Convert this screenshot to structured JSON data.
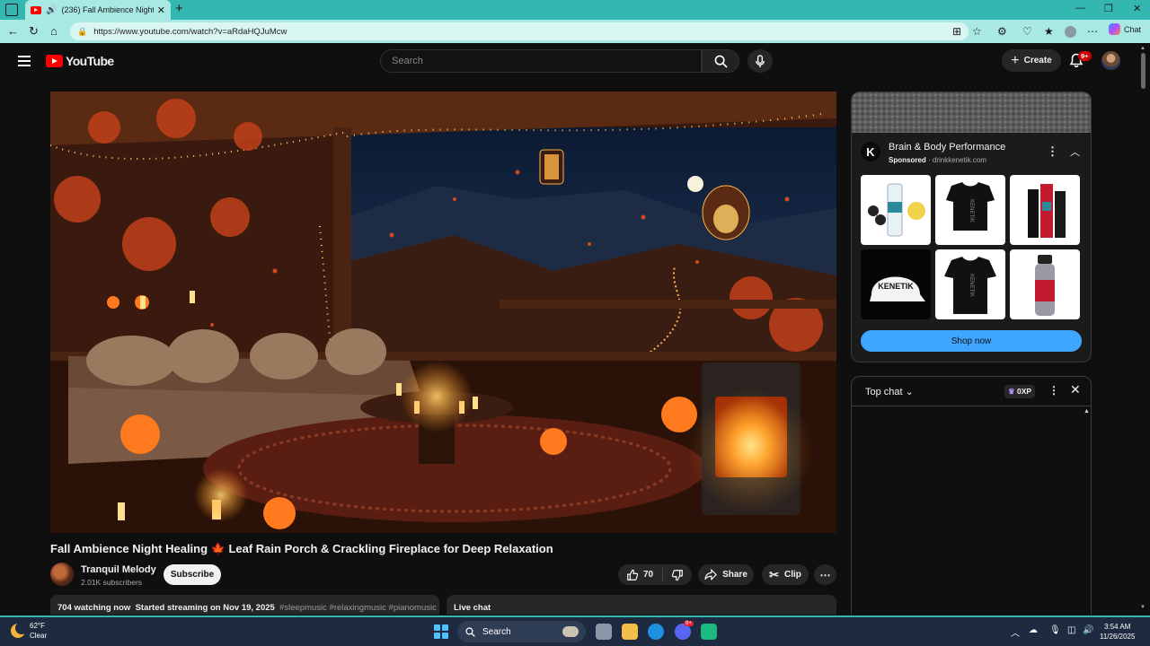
{
  "browser": {
    "tab_title": "(236) Fall Ambience Night H",
    "tab_close": "✕",
    "new_tab": "+",
    "url": "https://www.youtube.com/watch?v=aRdaHQJuMcw",
    "chat_label": "Chat",
    "min": "—",
    "max": "❐",
    "close": "✕"
  },
  "header": {
    "logo_text": "YouTube",
    "search_placeholder": "Search",
    "create_label": "Create",
    "notification_count": "9+"
  },
  "video": {
    "title": "Fall Ambience Night Healing 🍁 Leaf Rain Porch & Crackling Fireplace for Deep Relaxation",
    "channel_name": "Tranquil Melody",
    "subscribers": "2.01K subscribers",
    "subscribe_label": "Subscribe",
    "likes": "70",
    "share_label": "Share",
    "clip_label": "Clip",
    "watching": "704 watching now",
    "started": "Started streaming on Nov 19, 2025",
    "tags": "#sleepmusic #relaxingmusic #pianomusic",
    "live_chat_label": "Live chat"
  },
  "ad": {
    "title": "Brain & Body Performance",
    "sponsored": "Sponsored",
    "domain": "drinkkenetik.com",
    "logo_letter": "K",
    "shop_label": "Shop now",
    "products": [
      "drink-pack",
      "black-crop-top",
      "drink-boxes",
      "white-cap",
      "black-tshirt",
      "water-bottle"
    ]
  },
  "chat": {
    "title": "Top chat",
    "xp": "0XP"
  },
  "taskbar": {
    "temperature": "62°F",
    "condition": "Clear",
    "search_label": "Search",
    "time": "3:54 AM",
    "date": "11/26/2025",
    "discord_badge": "9+"
  },
  "colors": {
    "youtube_red": "#ff0000",
    "browser_teal": "#34b7b0",
    "shop_blue": "#3ea6ff"
  }
}
